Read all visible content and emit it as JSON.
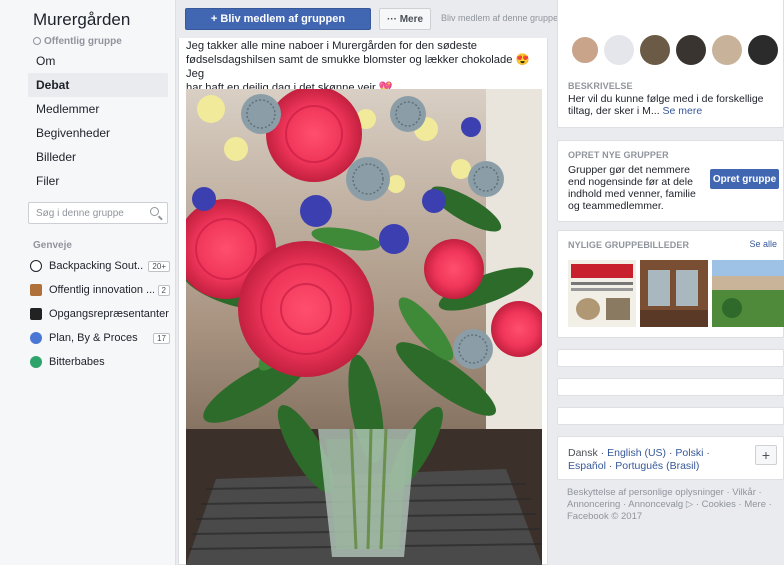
{
  "group": {
    "name": "Murergården",
    "type": "Offentlig gruppe"
  },
  "nav": {
    "items": [
      {
        "label": "Om"
      },
      {
        "label": "Debat"
      },
      {
        "label": "Medlemmer"
      },
      {
        "label": "Begivenheder"
      },
      {
        "label": "Billeder"
      },
      {
        "label": "Filer"
      }
    ],
    "active": "Debat"
  },
  "search": {
    "placeholder": "Søg i denne gruppe"
  },
  "shortcuts": {
    "title": "Genveje",
    "items": [
      {
        "label": "Backpacking Sout...",
        "count": "20+",
        "icon": "soccer-ball-icon",
        "color": "#1d2129"
      },
      {
        "label": "Offentlig innovation ...",
        "count": "2",
        "icon": "briefcase-icon",
        "color": "#a0522d"
      },
      {
        "label": "Opgangsrepræsentanter",
        "count": "",
        "icon": "group-thumbnail-icon",
        "color": "#222222"
      },
      {
        "label": "Plan, By & Proces",
        "count": "17",
        "icon": "people-icon",
        "color": "#4a76d4"
      },
      {
        "label": "Bitterbabes",
        "count": "",
        "icon": "globe-icon",
        "color": "#2ea36b"
      }
    ]
  },
  "header": {
    "join_label": "+ Bliv medlem af gruppen",
    "more_label": "··· Mere",
    "join_hint": "Bliv medlem af denne gruppe for at lave opslag og kommentere."
  },
  "post": {
    "text_line1": "Jeg takker alle mine naboer i Murergården for den sødeste",
    "text_line2": "fødselsdagshilsen samt de smukke blomster og lækker chokolade",
    "emoji1": "😍",
    "text_line2b": "Jeg",
    "text_line3": "har haft en dejlig dag i det skønne vejr",
    "emoji2": "💖"
  },
  "about": {
    "heading": "Beskrivelse",
    "text": "Her vil du kunne følge med i de forskellige tiltag, der sker i M...",
    "see_more": "Se mere"
  },
  "create_group": {
    "heading": "Opret nye grupper",
    "text": "Grupper gør det nemmere end nogensinde før at dele indhold med venner, familie og teammedlemmer.",
    "button": "Opret gruppe"
  },
  "recent_photos": {
    "heading": "Nylige gruppebilleder",
    "see_all": "Se alle"
  },
  "languages": {
    "current": "Dansk",
    "sep": " · ",
    "others": [
      "English (US)",
      "Polski",
      "Español",
      "Português (Brasil)"
    ]
  },
  "footer": {
    "text": "Beskyttelse af personlige oplysninger · Vilkår · Annoncering · Annoncevalg ▷ · Cookies · Mere · Facebook © 2017"
  },
  "colors": {
    "brand_blue": "#4267b2",
    "link_blue": "#365899",
    "page_bg": "#e9ebee"
  }
}
